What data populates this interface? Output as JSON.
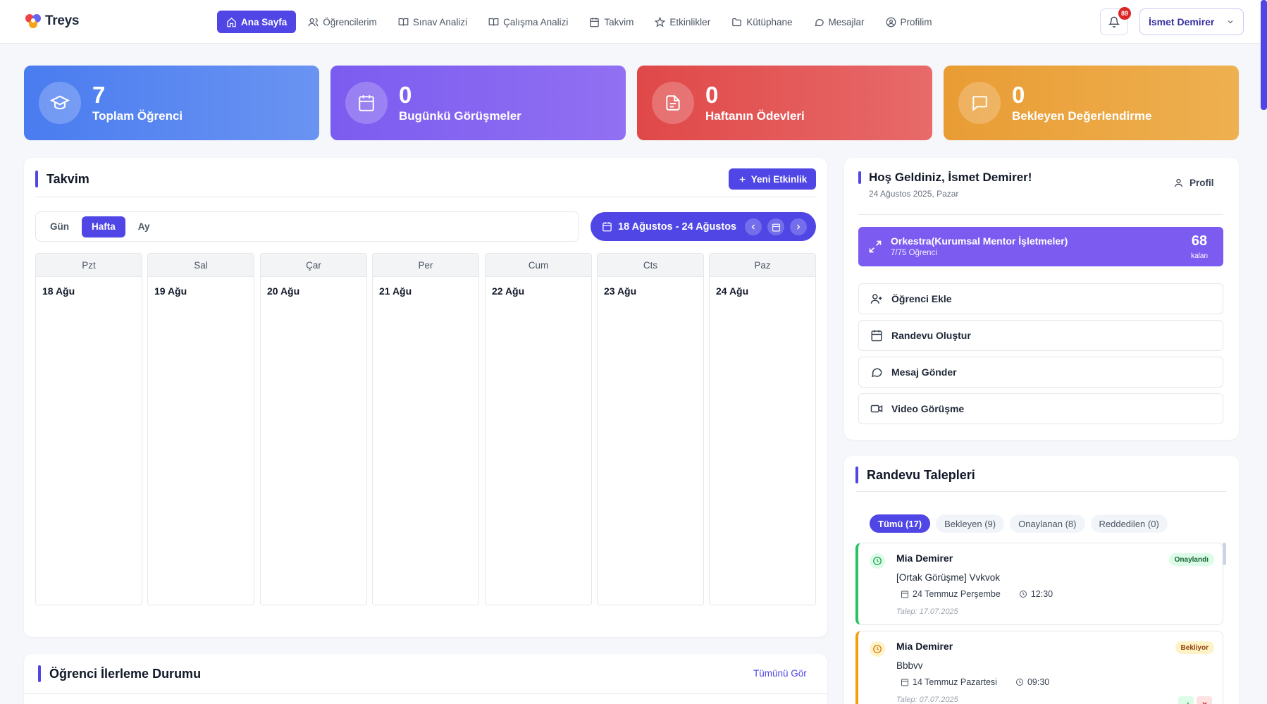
{
  "app": {
    "name": "Treys"
  },
  "nav": {
    "items": [
      {
        "label": "Ana Sayfa",
        "icon": "home-icon"
      },
      {
        "label": "Öğrencilerim",
        "icon": "users-icon"
      },
      {
        "label": "Sınav Analizi",
        "icon": "book-icon"
      },
      {
        "label": "Çalışma Analizi",
        "icon": "book-icon"
      },
      {
        "label": "Takvim",
        "icon": "calendar-icon"
      },
      {
        "label": "Etkinlikler",
        "icon": "star-icon"
      },
      {
        "label": "Kütüphane",
        "icon": "folder-icon"
      },
      {
        "label": "Mesajlar",
        "icon": "message-icon"
      },
      {
        "label": "Profilim",
        "icon": "user-circle-icon"
      }
    ],
    "notification_count": "89",
    "user_name": "İsmet Demirer"
  },
  "stats": [
    {
      "value": "7",
      "label": "Toplam Öğrenci",
      "color": "#4f7ff0"
    },
    {
      "value": "0",
      "label": "Bugünkü Görüşmeler",
      "color": "#7f5ef0"
    },
    {
      "value": "0",
      "label": "Haftanın Ödevleri",
      "color": "#e14d4d"
    },
    {
      "value": "0",
      "label": "Bekleyen Değerlendirme",
      "color": "#eaa23c"
    }
  ],
  "calendar": {
    "title": "Takvim",
    "new_event_label": "Yeni Etkinlik",
    "views": [
      "Gün",
      "Hafta",
      "Ay"
    ],
    "active_view": "Hafta",
    "range_label": "18 Ağustos - 24 Ağustos",
    "days": [
      {
        "name": "Pzt",
        "date": "18 Ağu"
      },
      {
        "name": "Sal",
        "date": "19 Ağu"
      },
      {
        "name": "Çar",
        "date": "20 Ağu"
      },
      {
        "name": "Per",
        "date": "21 Ağu"
      },
      {
        "name": "Cum",
        "date": "22 Ağu"
      },
      {
        "name": "Cts",
        "date": "23 Ağu"
      },
      {
        "name": "Paz",
        "date": "24 Ağu"
      }
    ]
  },
  "welcome": {
    "title": "Hoş Geldiniz, İsmet Demirer!",
    "date": "24 Ağustos 2025, Pazar",
    "profile_label": "Profil",
    "org": {
      "name": "Orkestra(Kurumsal Mentor İşletmeler)",
      "students": "7/75 Öğrenci",
      "remaining": "68",
      "remaining_label": "kalan"
    },
    "actions": [
      "Öğrenci Ekle",
      "Randevu Oluştur",
      "Mesaj Gönder",
      "Video Görüşme"
    ]
  },
  "requests": {
    "title": "Randevu Talepleri",
    "filters": [
      "Tümü (17)",
      "Bekleyen (9)",
      "Onaylanan (8)",
      "Reddedilen (0)"
    ],
    "items": [
      {
        "name": "Mia Demirer",
        "topic": "[Ortak Görüşme] Vvkvok",
        "date": "24 Temmuz Perşembe",
        "time": "12:30",
        "talep": "Talep: 17.07.2025",
        "status": "Onaylandı"
      },
      {
        "name": "Mia Demirer",
        "topic": "Bbbvv",
        "date": "14 Temmuz Pazartesi",
        "time": "09:30",
        "talep": "Talep: 07.07.2025",
        "status": "Bekliyor"
      }
    ]
  },
  "progress": {
    "title": "Öğrenci İlerleme Durumu",
    "see_all": "Tümünü Gör"
  }
}
